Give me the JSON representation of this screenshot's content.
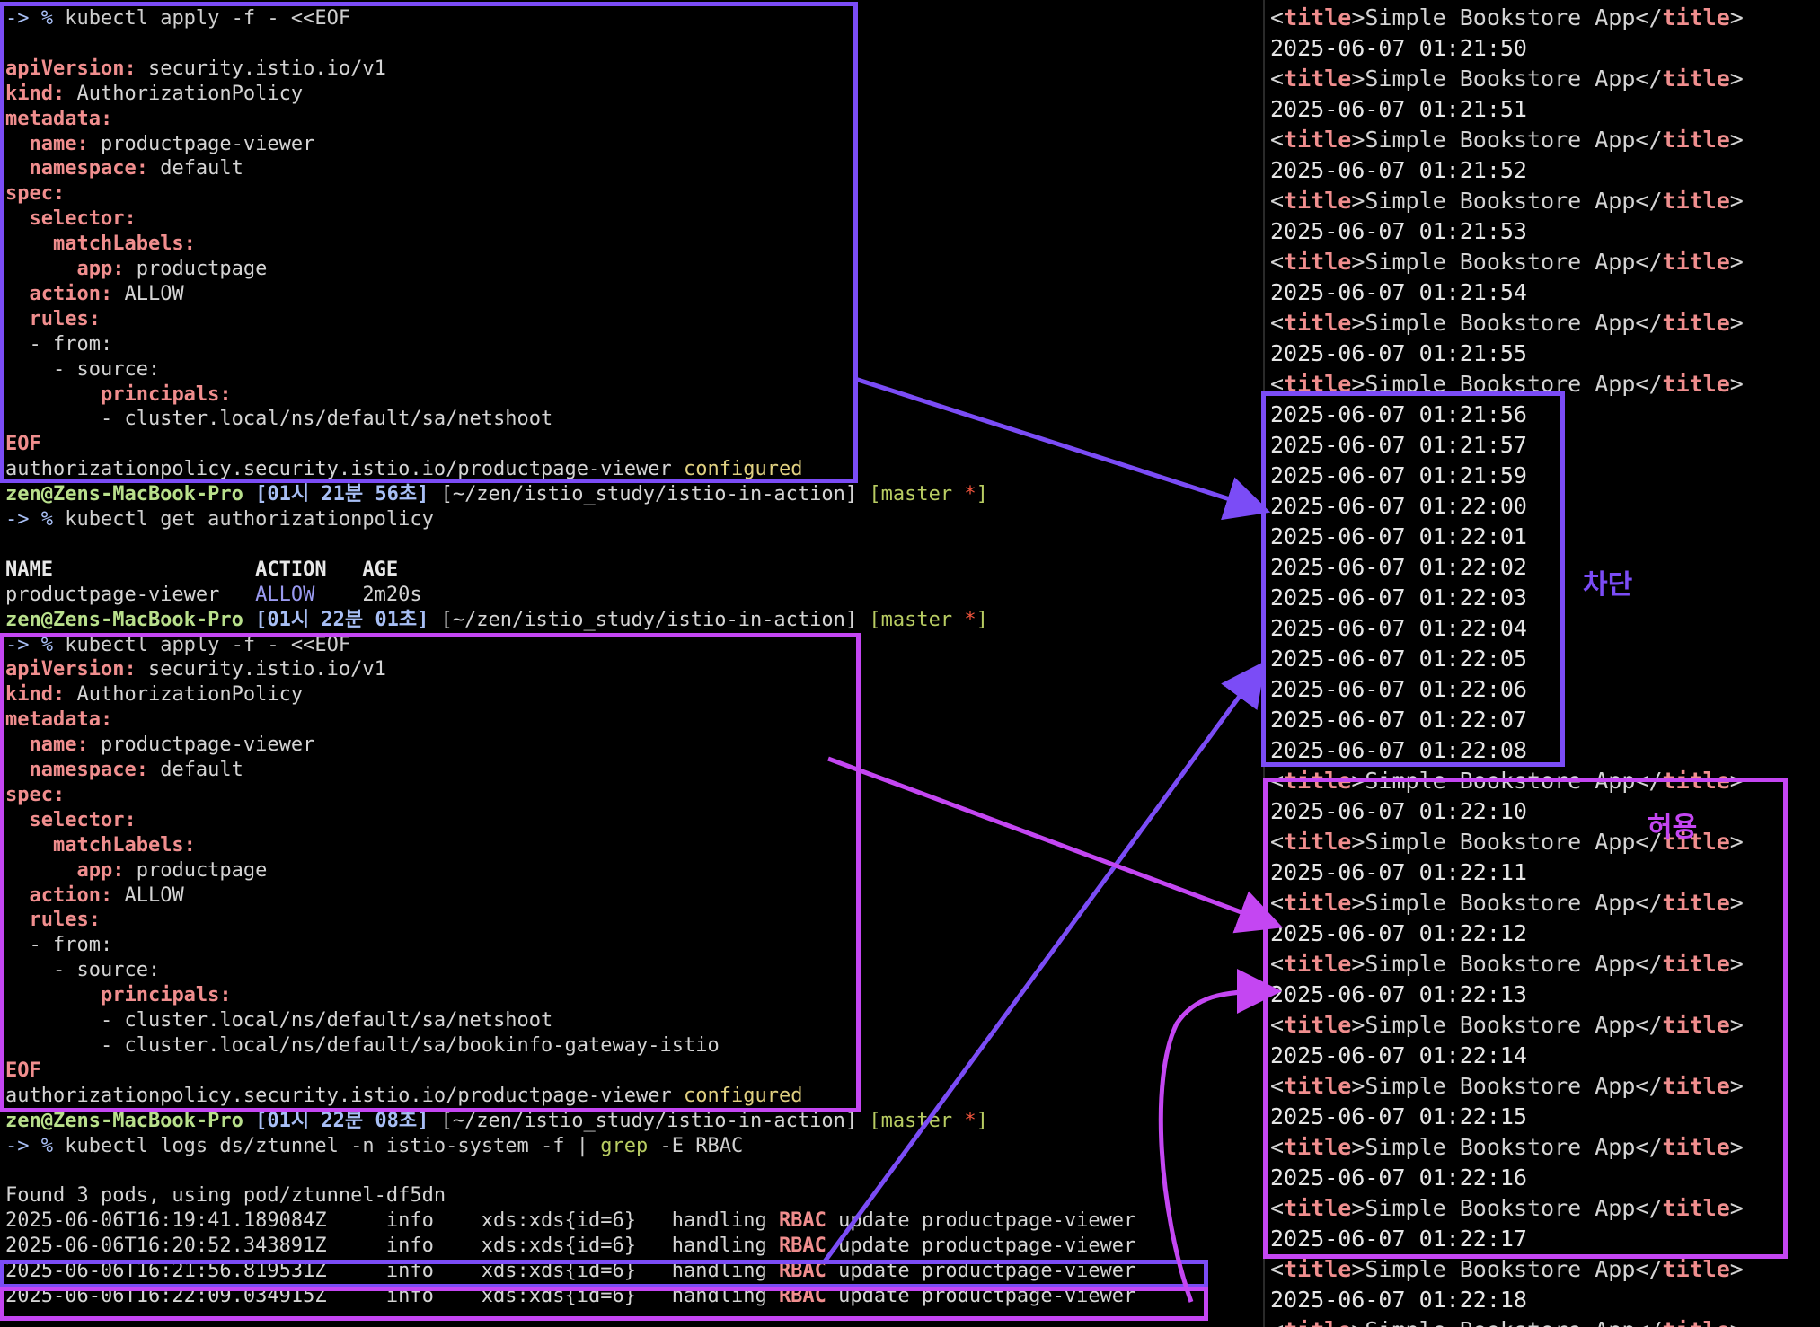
{
  "colors": {
    "purple": "#7b4cf6",
    "magenta": "#c446f2"
  },
  "left": {
    "lines": [
      [
        [
          "arrow-prompt",
          "-> % "
        ],
        [
          "cmd",
          "kubectl apply -f - <<EOF"
        ]
      ],
      [],
      [
        [
          "key",
          "apiVersion:"
        ],
        [
          "txt",
          " security.istio.io/v1"
        ]
      ],
      [
        [
          "key",
          "kind:"
        ],
        [
          "txt",
          " AuthorizationPolicy"
        ]
      ],
      [
        [
          "key",
          "metadata:"
        ]
      ],
      [
        [
          "txt",
          "  "
        ],
        [
          "key",
          "name:"
        ],
        [
          "txt",
          " productpage-viewer"
        ]
      ],
      [
        [
          "txt",
          "  "
        ],
        [
          "key",
          "namespace:"
        ],
        [
          "txt",
          " default"
        ]
      ],
      [
        [
          "key",
          "spec:"
        ]
      ],
      [
        [
          "txt",
          "  "
        ],
        [
          "key",
          "selector:"
        ]
      ],
      [
        [
          "txt",
          "    "
        ],
        [
          "key",
          "matchLabels:"
        ]
      ],
      [
        [
          "txt",
          "      "
        ],
        [
          "key",
          "app:"
        ],
        [
          "txt",
          " productpage"
        ]
      ],
      [
        [
          "txt",
          "  "
        ],
        [
          "key",
          "action:"
        ],
        [
          "txt",
          " ALLOW"
        ]
      ],
      [
        [
          "txt",
          "  "
        ],
        [
          "key",
          "rules:"
        ]
      ],
      [
        [
          "txt",
          "  - from:"
        ]
      ],
      [
        [
          "txt",
          "    - source:"
        ]
      ],
      [
        [
          "txt",
          "        "
        ],
        [
          "key",
          "principals:"
        ]
      ],
      [
        [
          "txt",
          "        - cluster.local/ns/default/sa/netshoot"
        ]
      ],
      [
        [
          "key",
          "EOF"
        ]
      ],
      [
        [
          "txt",
          "authorizationpolicy.security.istio.io/productpage-viewer "
        ],
        [
          "conf",
          "configured"
        ]
      ],
      [
        [
          "user",
          "zen@Zens-MacBook-Pro"
        ],
        [
          "bracket",
          " [01시 21분 56초]"
        ],
        [
          "path",
          " [~/zen/istio_study/istio-in-action]"
        ],
        [
          "git",
          " [master "
        ],
        [
          "star",
          "*"
        ],
        [
          "git",
          "]"
        ]
      ],
      [
        [
          "arrow-prompt",
          "-> % "
        ],
        [
          "cmd",
          "kubectl get authorizationpolicy"
        ]
      ],
      [],
      [
        [
          "hdr",
          "NAME                 ACTION   AGE"
        ]
      ],
      [
        [
          "txt",
          "productpage-viewer   "
        ],
        [
          "allow",
          "ALLOW"
        ],
        [
          "txt",
          "    2m20s"
        ]
      ],
      [
        [
          "user",
          "zen@Zens-MacBook-Pro"
        ],
        [
          "bracket",
          " [01시 22분 01초]"
        ],
        [
          "path",
          " [~/zen/istio_study/istio-in-action]"
        ],
        [
          "git",
          " [master "
        ],
        [
          "star",
          "*"
        ],
        [
          "git",
          "]"
        ]
      ],
      [
        [
          "arrow-prompt",
          "-> % "
        ],
        [
          "cmd",
          "kubectl apply -f - <<EOF"
        ]
      ],
      [
        [
          "key",
          "apiVersion:"
        ],
        [
          "txt",
          " security.istio.io/v1"
        ]
      ],
      [
        [
          "key",
          "kind:"
        ],
        [
          "txt",
          " AuthorizationPolicy"
        ]
      ],
      [
        [
          "key",
          "metadata:"
        ]
      ],
      [
        [
          "txt",
          "  "
        ],
        [
          "key",
          "name:"
        ],
        [
          "txt",
          " productpage-viewer"
        ]
      ],
      [
        [
          "txt",
          "  "
        ],
        [
          "key",
          "namespace:"
        ],
        [
          "txt",
          " default"
        ]
      ],
      [
        [
          "key",
          "spec:"
        ]
      ],
      [
        [
          "txt",
          "  "
        ],
        [
          "key",
          "selector:"
        ]
      ],
      [
        [
          "txt",
          "    "
        ],
        [
          "key",
          "matchLabels:"
        ]
      ],
      [
        [
          "txt",
          "      "
        ],
        [
          "key",
          "app:"
        ],
        [
          "txt",
          " productpage"
        ]
      ],
      [
        [
          "txt",
          "  "
        ],
        [
          "key",
          "action:"
        ],
        [
          "txt",
          " ALLOW"
        ]
      ],
      [
        [
          "txt",
          "  "
        ],
        [
          "key",
          "rules:"
        ]
      ],
      [
        [
          "txt",
          "  - from:"
        ]
      ],
      [
        [
          "txt",
          "    - source:"
        ]
      ],
      [
        [
          "txt",
          "        "
        ],
        [
          "key",
          "principals:"
        ]
      ],
      [
        [
          "txt",
          "        - cluster.local/ns/default/sa/netshoot"
        ]
      ],
      [
        [
          "txt",
          "        - cluster.local/ns/default/sa/bookinfo-gateway-istio"
        ]
      ],
      [
        [
          "key",
          "EOF"
        ]
      ],
      [
        [
          "txt",
          "authorizationpolicy.security.istio.io/productpage-viewer "
        ],
        [
          "conf",
          "configured"
        ]
      ],
      [
        [
          "user",
          "zen@Zens-MacBook-Pro"
        ],
        [
          "bracket",
          " [01시 22분 08초]"
        ],
        [
          "path",
          " [~/zen/istio_study/istio-in-action]"
        ],
        [
          "git",
          " [master "
        ],
        [
          "star",
          "*"
        ],
        [
          "git",
          "]"
        ]
      ],
      [
        [
          "arrow-prompt",
          "-> % "
        ],
        [
          "cmd",
          "kubectl logs ds/ztunnel -n istio-system -f | "
        ],
        [
          "git",
          "grep"
        ],
        [
          "cmd",
          " -E RBAC"
        ]
      ],
      [],
      [
        [
          "txt",
          "Found 3 pods, using pod/ztunnel-df5dn"
        ]
      ],
      [
        [
          "txt",
          "2025-06-06T16:19:41.189084Z     info    xds:xds{id=6}   handling "
        ],
        [
          "rbac",
          "RBAC"
        ],
        [
          "txt",
          " update productpage-viewer"
        ]
      ],
      [
        [
          "txt",
          "2025-06-06T16:20:52.343891Z     info    xds:xds{id=6}   handling "
        ],
        [
          "rbac",
          "RBAC"
        ],
        [
          "txt",
          " update productpage-viewer"
        ]
      ],
      [
        [
          "txt",
          "2025-06-06T16:21:56.819531Z     info    xds:xds{id=6}   handling "
        ],
        [
          "rbac",
          "RBAC"
        ],
        [
          "txt",
          " update productpage-viewer"
        ]
      ],
      [
        [
          "txt",
          "2025-06-06T16:22:09.034915Z     info    xds:xds{id=6}   handling "
        ],
        [
          "rbac",
          "RBAC"
        ],
        [
          "txt",
          " update productpage-viewer"
        ]
      ]
    ]
  },
  "right": {
    "lines": [
      "T",
      "2025-06-07 01:21:50",
      "T",
      "2025-06-07 01:21:51",
      "T",
      "2025-06-07 01:21:52",
      "T",
      "2025-06-07 01:21:53",
      "T",
      "2025-06-07 01:21:54",
      "T",
      "2025-06-07 01:21:55",
      "T",
      "2025-06-07 01:21:56",
      "2025-06-07 01:21:57",
      "2025-06-07 01:21:59",
      "2025-06-07 01:22:00",
      "2025-06-07 01:22:01",
      "2025-06-07 01:22:02",
      "2025-06-07 01:22:03",
      "2025-06-07 01:22:04",
      "2025-06-07 01:22:05",
      "2025-06-07 01:22:06",
      "2025-06-07 01:22:07",
      "2025-06-07 01:22:08",
      "T",
      "2025-06-07 01:22:10",
      "T",
      "2025-06-07 01:22:11",
      "T",
      "2025-06-07 01:22:12",
      "T",
      "2025-06-07 01:22:13",
      "T",
      "2025-06-07 01:22:14",
      "T",
      "2025-06-07 01:22:15",
      "T",
      "2025-06-07 01:22:16",
      "T",
      "2025-06-07 01:22:17",
      "T",
      "2025-06-07 01:22:18",
      "T"
    ],
    "title_open": "<",
    "title_tag": "title",
    "title_mid": ">Simple Bookstore App</",
    "title_close": ">"
  },
  "annotations": {
    "blocked_label": "차단",
    "allowed_label": "허용"
  }
}
